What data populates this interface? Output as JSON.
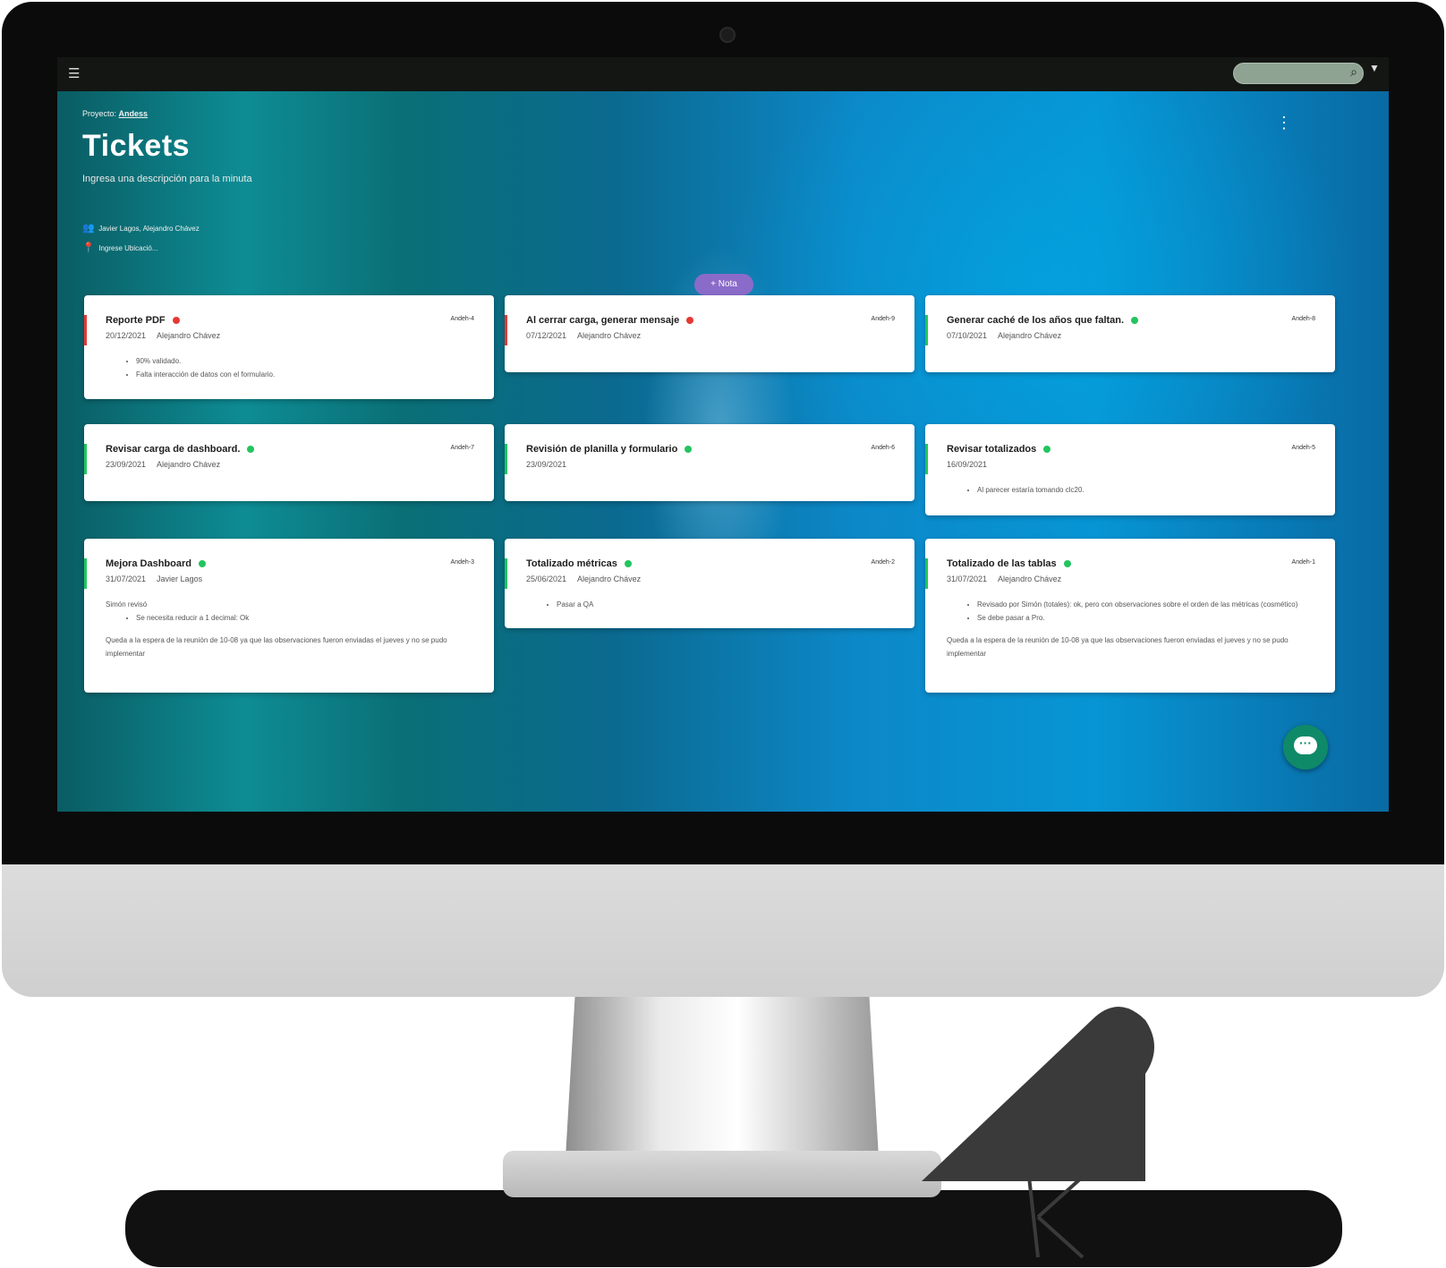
{
  "app": {
    "breadcrumb_prefix": "Proyecto:",
    "breadcrumb_project": "Andess",
    "title": "Tickets",
    "subtitle": "Ingresa una descripción para la minuta",
    "members": "Javier Lagos, Alejandro Chávez",
    "location": "Ingrese Ubicació...",
    "add_note_label": "+ Nota",
    "search_placeholder": ""
  },
  "colors": {
    "red": "#e53935",
    "green": "#22c55e"
  },
  "cards": [
    {
      "title": "Reporte PDF",
      "status": "red",
      "code": "Andeh-4",
      "date": "20/12/2021",
      "author": "Alejandro Chávez",
      "notes": [
        "90% validado.",
        "Falta interacción de datos con el formulario."
      ]
    },
    {
      "title": "Al cerrar carga, generar mensaje",
      "status": "red",
      "code": "Andeh-9",
      "date": "07/12/2021",
      "author": "Alejandro Chávez",
      "notes": []
    },
    {
      "title": "Generar caché de los años que faltan.",
      "status": "green",
      "code": "Andeh-8",
      "date": "07/10/2021",
      "author": "Alejandro Chávez",
      "notes": []
    },
    {
      "title": "Revisar carga de dashboard.",
      "status": "green",
      "code": "Andeh-7",
      "date": "23/09/2021",
      "author": "Alejandro Chávez",
      "notes": []
    },
    {
      "title": "Revisión de planilla y formulario",
      "status": "green",
      "code": "Andeh-6",
      "date": "23/09/2021",
      "author": "",
      "notes": []
    },
    {
      "title": "Revisar totalizados",
      "status": "green",
      "code": "Andeh-5",
      "date": "16/09/2021",
      "author": "",
      "notes": [
        "Al parecer estaría tomando clc20."
      ]
    },
    {
      "title": "Mejora Dashboard",
      "status": "green",
      "code": "Andeh-3",
      "date": "31/07/2021",
      "author": "Javier Lagos",
      "pre": "Simón revisó",
      "notes": [
        "Se necesita reducir a 1 decimal: Ok"
      ],
      "post": "Queda a la espera de la reunión de 10-08 ya que las observaciones fueron enviadas el jueves y no se pudo implementar"
    },
    {
      "title": "Totalizado métricas",
      "status": "green",
      "code": "Andeh-2",
      "date": "25/06/2021",
      "author": "Alejandro Chávez",
      "notes": [
        "Pasar a QA"
      ]
    },
    {
      "title": "Totalizado de las tablas",
      "status": "green",
      "code": "Andeh-1",
      "date": "31/07/2021",
      "author": "Alejandro Chávez",
      "notes": [
        "Revisado por Simón (totales): ok, pero con observaciones sobre el orden de las métricas (cosmético)",
        "Se debe pasar a Pro."
      ],
      "post": "Queda a la espera de la reunión de 10-08 ya que las observaciones fueron enviadas el jueves y no se pudo implementar"
    }
  ]
}
